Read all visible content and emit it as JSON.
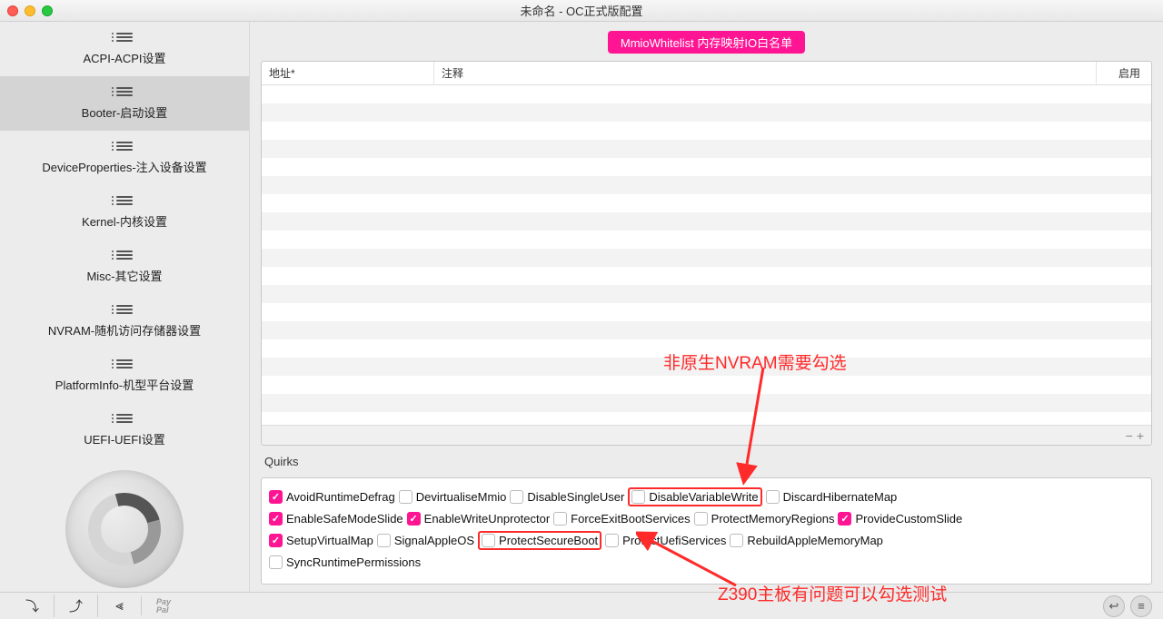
{
  "window": {
    "title": "未命名 - OC正式版配置"
  },
  "sidebar": {
    "items": [
      {
        "label": "ACPI-ACPI设置"
      },
      {
        "label": "Booter-启动设置"
      },
      {
        "label": "DeviceProperties-注入设备设置"
      },
      {
        "label": "Kernel-内核设置"
      },
      {
        "label": "Misc-其它设置"
      },
      {
        "label": "NVRAM-随机访问存储器设置"
      },
      {
        "label": "PlatformInfo-机型平台设置"
      },
      {
        "label": "UEFI-UEFI设置"
      }
    ],
    "selected_index": 1
  },
  "badge": "MmioWhitelist 内存映射IO白名单",
  "table": {
    "headers": {
      "address": "地址*",
      "comment": "注释",
      "enabled": "启用"
    },
    "footer": {
      "minus": "−",
      "plus": "+"
    }
  },
  "quirks": {
    "label": "Quirks",
    "rows": [
      [
        {
          "name": "AvoidRuntimeDefrag",
          "checked": true
        },
        {
          "name": "DevirtualiseMmio",
          "checked": false
        },
        {
          "name": "DisableSingleUser",
          "checked": false
        },
        {
          "name": "DisableVariableWrite",
          "checked": false,
          "boxed": true
        },
        {
          "name": "DiscardHibernateMap",
          "checked": false
        }
      ],
      [
        {
          "name": "EnableSafeModeSlide",
          "checked": true
        },
        {
          "name": "EnableWriteUnprotector",
          "checked": true
        },
        {
          "name": "ForceExitBootServices",
          "checked": false
        },
        {
          "name": "ProtectMemoryRegions",
          "checked": false
        },
        {
          "name": "ProvideCustomSlide",
          "checked": true
        }
      ],
      [
        {
          "name": "SetupVirtualMap",
          "checked": true
        },
        {
          "name": "SignalAppleOS",
          "checked": false
        },
        {
          "name": "ProtectSecureBoot",
          "checked": false,
          "boxed": true
        },
        {
          "name": "ProtectUefiServices",
          "checked": false
        },
        {
          "name": "RebuildAppleMemoryMap",
          "checked": false
        }
      ],
      [
        {
          "name": "SyncRuntimePermissions",
          "checked": false
        }
      ]
    ]
  },
  "annotations": {
    "nvram_note": "非原生NVRAM需要勾选",
    "z390_note": "Z390主板有问题可以勾选测试"
  },
  "bottombar": {
    "paypal": "Pay\nPal"
  }
}
